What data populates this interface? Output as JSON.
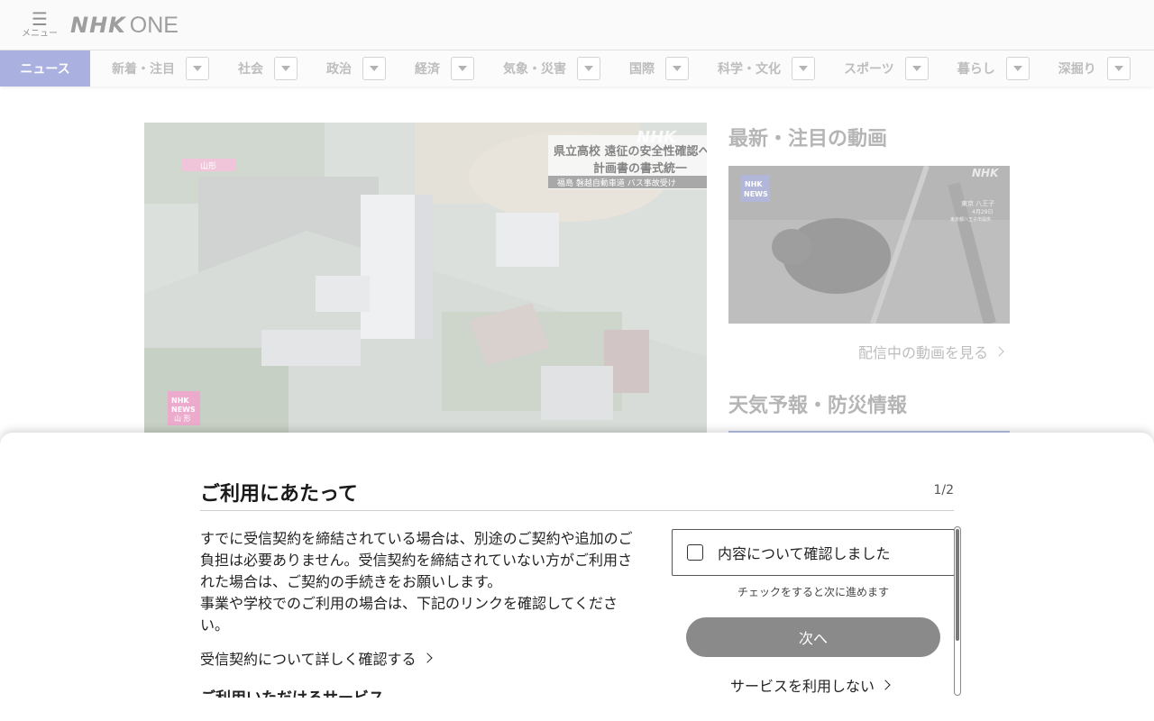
{
  "header": {
    "menu_icon": "hamburger-icon",
    "menu_label": "メニュー",
    "logo_nhk": "NHK",
    "logo_one": "ONE"
  },
  "nav": {
    "items": [
      {
        "label": "ニュース",
        "active": true
      },
      {
        "label": "新着・注目"
      },
      {
        "label": "社会"
      },
      {
        "label": "政治"
      },
      {
        "label": "経済"
      },
      {
        "label": "気象・災害"
      },
      {
        "label": "国際"
      },
      {
        "label": "科学・文化"
      },
      {
        "label": "スポーツ"
      },
      {
        "label": "暮らし"
      },
      {
        "label": "深掘り"
      }
    ]
  },
  "hero": {
    "caption_lines": [
      "県立高校 遠征の安全性確認へ",
      "計画書の書式統一"
    ],
    "caption_sub": "福島 磐越自動車道 バス事故受け",
    "watermark": "NHK",
    "badge_lines": [
      "NHK",
      "NEWS",
      "山 形"
    ],
    "pink_tag": "山形"
  },
  "sidebar": {
    "videos_title": "最新・注目の動画",
    "video_badge": [
      "NHK",
      "NEWS"
    ],
    "video_watermark": "NHK",
    "video_caption": [
      "東京 八王子",
      "4月29日",
      "東京都八王子市提供"
    ],
    "see_more": "配信中の動画を見る",
    "weather_title": "天気予報・防災情報"
  },
  "modal": {
    "title": "ご利用にあたって",
    "pager": "1/2",
    "body_lines": [
      "すでに受信契約を締結されている場合は、別途のご契約や追加のご負担は必要ありません。受信契約を締結されていない方がご利用された場合は、ご契約の手続きをお願いします。",
      "事業や学校でのご利用の場合は、下記のリンクを確認してください。"
    ],
    "contract_link": "受信契約について詳しく確認する",
    "cut_heading": "ご利用いただけるサービス",
    "confirm_label": "内容について確認しました",
    "hint": "チェックをすると次に進めます",
    "next_label": "次へ",
    "no_service_label": "サービスを利用しない"
  },
  "colors": {
    "nav_active": "#7d86cf",
    "next_button": "#8a8a8a"
  }
}
